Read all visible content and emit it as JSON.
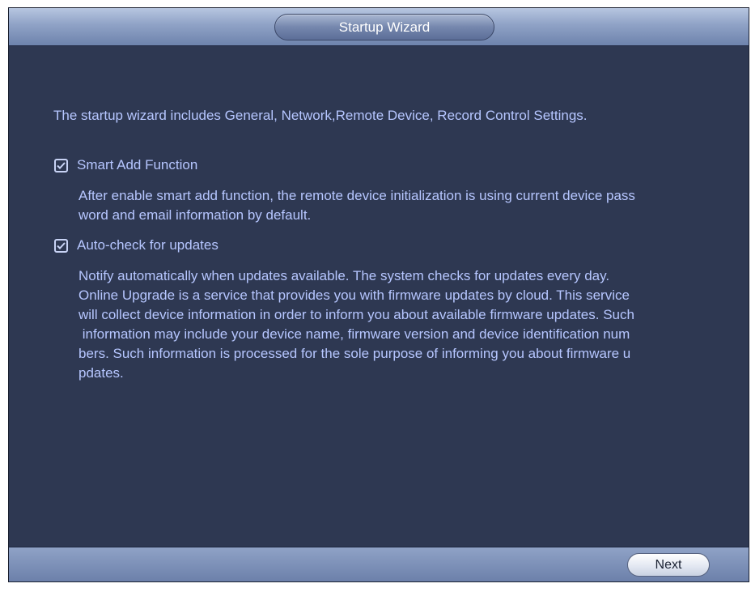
{
  "window": {
    "title": "Startup Wizard"
  },
  "intro_text": "The startup wizard includes General, Network,Remote Device, Record Control Settings.",
  "options": [
    {
      "label": "Smart Add Function",
      "checked": true,
      "description_lines": [
        "After enable smart add function, the remote device initialization is using current device pass",
        "word and email information by default."
      ]
    },
    {
      "label": "Auto-check for updates",
      "checked": true,
      "description_lines": [
        "Notify automatically when updates available. The system checks for updates every day.",
        "Online Upgrade is a service that provides you with firmware updates by cloud. This service",
        "will collect device information in order to inform you about available firmware updates. Such",
        " information may include your device name, firmware version and device identification num",
        "bers. Such information is processed for the sole purpose of informing you about firmware u",
        "pdates."
      ]
    }
  ],
  "footer": {
    "next_label": "Next"
  },
  "colors": {
    "panel_background": "#2e3852",
    "text": "#b6c6ff",
    "title_bar": "#8fa2c6"
  },
  "icons": {
    "checkbox": "checkbox-checked-icon"
  }
}
